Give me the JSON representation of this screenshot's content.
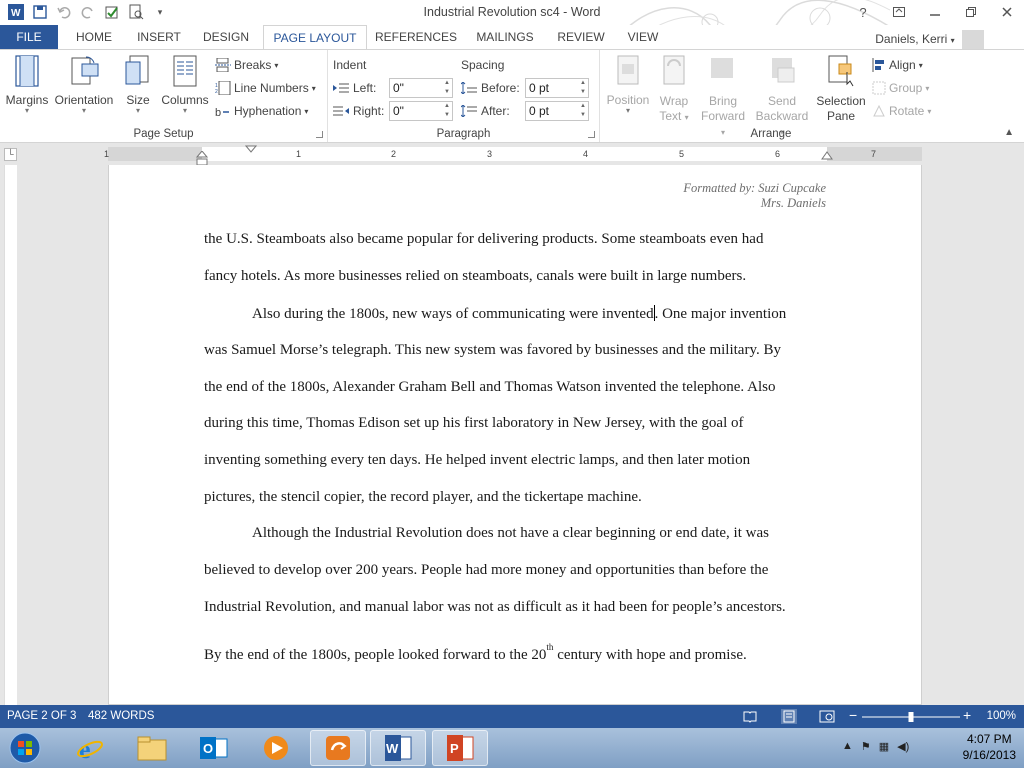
{
  "window": {
    "title": "Industrial Revolution sc4 - Word",
    "controls": [
      "?",
      "restore",
      "minimize",
      "maximize",
      "close"
    ]
  },
  "quick_access": [
    "word-logo-icon",
    "save-icon",
    "undo-icon",
    "redo-icon",
    "spelling-icon",
    "print-preview-icon",
    "customize-icon"
  ],
  "tabs": {
    "file": "FILE",
    "items": [
      "HOME",
      "INSERT",
      "DESIGN",
      "PAGE LAYOUT",
      "REFERENCES",
      "MAILINGS",
      "REVIEW",
      "VIEW"
    ],
    "active": "PAGE LAYOUT",
    "user": "Daniels, Kerri"
  },
  "ribbon": {
    "page_setup": {
      "label": "Page Setup",
      "margins": "Margins",
      "orientation": "Orientation",
      "size": "Size",
      "columns": "Columns",
      "breaks": "Breaks",
      "line_numbers": "Line Numbers",
      "hyphenation": "Hyphenation"
    },
    "paragraph": {
      "label": "Paragraph",
      "indent_title": "Indent",
      "spacing_title": "Spacing",
      "left_label": "Left:",
      "left_value": "0\"",
      "right_label": "Right:",
      "right_value": "0\"",
      "before_label": "Before:",
      "before_value": "0 pt",
      "after_label": "After:",
      "after_value": "0 pt"
    },
    "arrange": {
      "label": "Arrange",
      "position": "Position",
      "wrap_text_1": "Wrap",
      "wrap_text_2": "Text",
      "bring_forward_1": "Bring",
      "bring_forward_2": "Forward",
      "send_backward_1": "Send",
      "send_backward_2": "Backward",
      "selection_pane_1": "Selection",
      "selection_pane_2": "Pane",
      "align": "Align",
      "group": "Group",
      "rotate": "Rotate"
    }
  },
  "ruler": {
    "numbers": [
      "1",
      "1",
      "2",
      "3",
      "4",
      "5",
      "6",
      "7"
    ]
  },
  "document": {
    "header_line1": "Formatted by: Suzi Cupcake",
    "header_line2": "Mrs. Daniels",
    "lines": [
      "the U.S. Steamboats also became popular for delivering products. Some steamboats even had",
      "fancy hotels. As more businesses relied on steamboats, canals were built in large numbers.",
      "Also during the 1800s, new ways of communicating were invented",
      ". One major invention",
      "was Samuel Morse’s telegraph. This new system was favored by businesses and the military. By",
      "the end of the 1800s, Alexander Graham Bell and Thomas Watson invented the telephone. Also",
      "during this time, Thomas Edison set up his first laboratory in New Jersey, with the goal of",
      "inventing something every ten days. He helped invent electric lamps, and then later motion",
      "pictures, the stencil copier, the record player, and the tickertape machine.",
      "Although the Industrial Revolution does not have a clear beginning or end date, it was",
      "believed to develop over 200 years. People had more money and opportunities than before the",
      "Industrial Revolution, and manual labor was not as difficult as it had been for people’s ancestors.",
      "By the end of the 1800s, people looked forward to the 20",
      "th",
      " century with hope and promise."
    ]
  },
  "status": {
    "page": "PAGE 2 OF 3",
    "words": "482 WORDS",
    "zoom": "100%",
    "zoom_level_percent": 100
  },
  "taskbar": {
    "time": "4:07 PM",
    "date": "9/16/2013",
    "apps": [
      "start-orb-icon",
      "internet-explorer-icon",
      "file-explorer-icon",
      "outlook-icon",
      "media-player-icon",
      "switcher-icon",
      "word-icon",
      "powerpoint-icon"
    ]
  },
  "colors": {
    "accent": "#2b579a",
    "ribbon_bg": "#ffffff",
    "workspace": "#e6e6e6"
  }
}
